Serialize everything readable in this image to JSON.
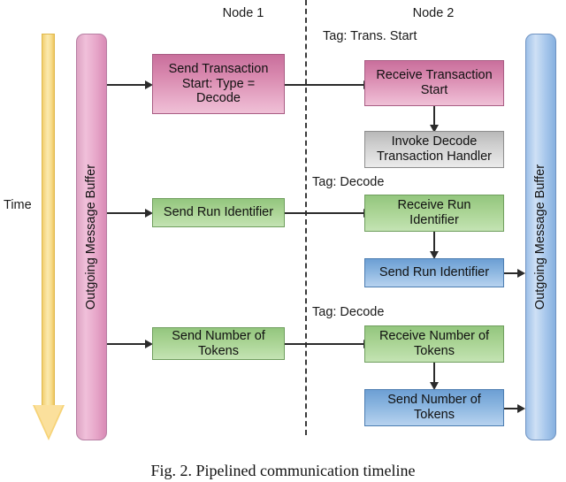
{
  "figure": {
    "caption": "Fig. 2.  Pipelined communication timeline",
    "time_axis_label": "Time"
  },
  "columns": [
    {
      "id": "node1",
      "label": "Node 1"
    },
    {
      "id": "node2",
      "label": "Node 2"
    }
  ],
  "buffers": [
    {
      "id": "left-buffer",
      "label": "Outgoing Message Buffer",
      "color": "#e8a9cb"
    },
    {
      "id": "right-buffer",
      "label": "Outgoing Message Buffer",
      "color": "#a8c8ec"
    }
  ],
  "tags": [
    {
      "id": "tag-trans-start",
      "label": "Tag: Trans. Start"
    },
    {
      "id": "tag-decode-1",
      "label": "Tag: Decode"
    },
    {
      "id": "tag-decode-2",
      "label": "Tag: Decode"
    }
  ],
  "boxes": [
    {
      "id": "send-transaction-start",
      "column": "node1",
      "label": "Send Transaction Start: Type = Decode",
      "line1": "Send Transaction",
      "line2": "Start: Type =",
      "line3": "Decode",
      "color": "#d888ae",
      "kind": "send"
    },
    {
      "id": "receive-transaction-start",
      "column": "node2",
      "label": "Receive Transaction Start",
      "line1": "Receive Transaction",
      "line2": "Start",
      "color": "#d888ae",
      "kind": "receive"
    },
    {
      "id": "invoke-decode-transaction-handler",
      "column": "node2",
      "label": "Invoke Decode Transaction Handler",
      "line1": "Invoke Decode",
      "line2": "Transaction Handler",
      "color": "#cfcfcf",
      "kind": "handler"
    },
    {
      "id": "send-run-identifier-node1",
      "column": "node1",
      "label": "Send Run Identifier",
      "line1": "Send Run Identifier",
      "color": "#a7d291",
      "kind": "send"
    },
    {
      "id": "receive-run-identifier",
      "column": "node2",
      "label": "Receive Run Identifier",
      "line1": "Receive Run",
      "line2": "Identifier",
      "color": "#a7d291",
      "kind": "receive"
    },
    {
      "id": "send-run-identifier-node2",
      "column": "node2",
      "label": "Send Run Identifier",
      "line1": "Send Run Identifier",
      "color": "#86b2de",
      "kind": "send"
    },
    {
      "id": "send-number-of-tokens-node1",
      "column": "node1",
      "label": "Send Number of Tokens",
      "line1": "Send Number of",
      "line2": "Tokens",
      "color": "#a7d291",
      "kind": "send"
    },
    {
      "id": "receive-number-of-tokens",
      "column": "node2",
      "label": "Receive Number of Tokens",
      "line1": "Receive Number of",
      "line2": "Tokens",
      "color": "#a7d291",
      "kind": "receive"
    },
    {
      "id": "send-number-of-tokens-node2",
      "column": "node2",
      "label": "Send Number of Tokens",
      "line1": "Send Number of",
      "line2": "Tokens",
      "color": "#86b2de",
      "kind": "send"
    }
  ]
}
